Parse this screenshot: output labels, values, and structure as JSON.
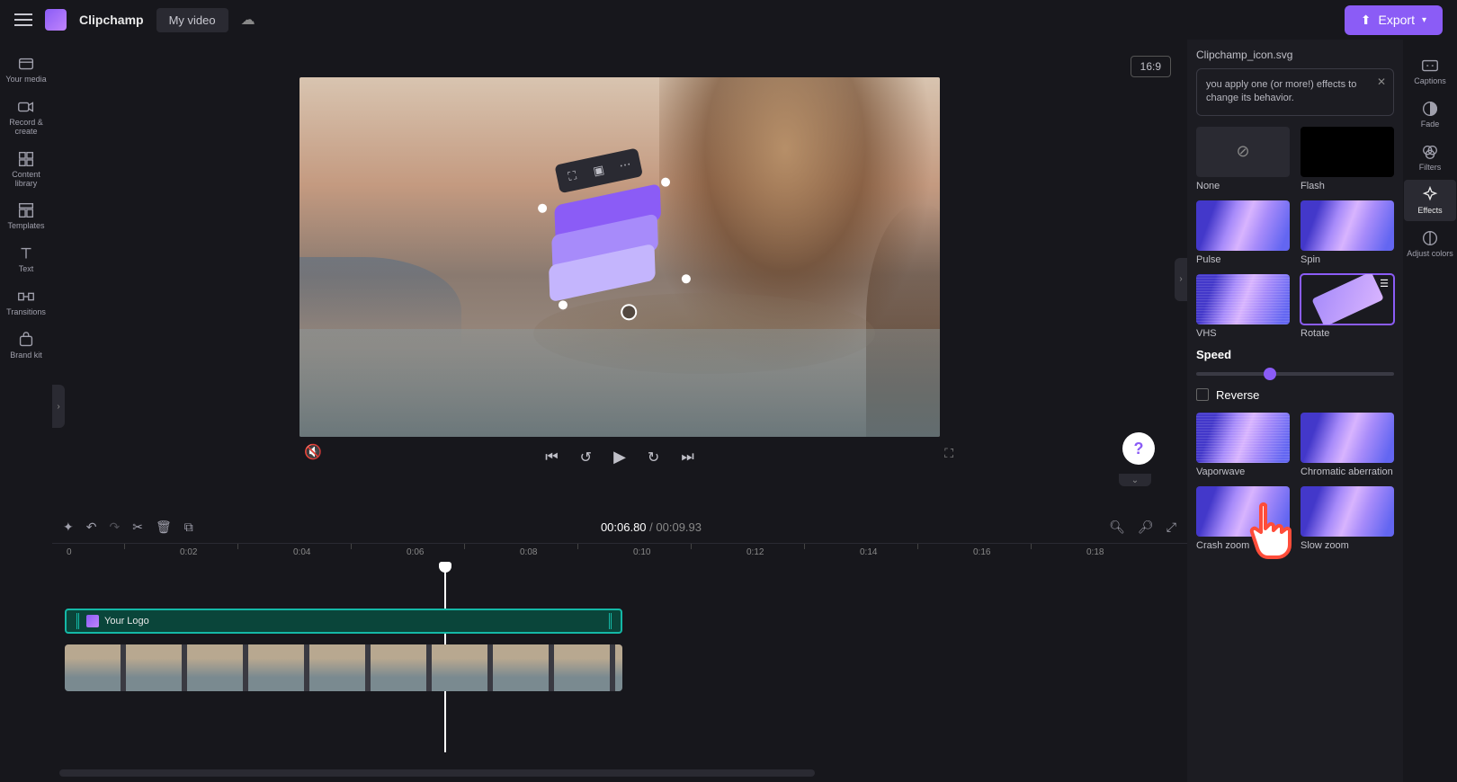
{
  "topbar": {
    "brand": "Clipchamp",
    "tab": "My video",
    "export": "Export"
  },
  "leftNav": {
    "items": [
      {
        "label": "Your media"
      },
      {
        "label": "Record & create"
      },
      {
        "label": "Content library"
      },
      {
        "label": "Templates"
      },
      {
        "label": "Text"
      },
      {
        "label": "Transitions"
      },
      {
        "label": "Brand kit"
      }
    ]
  },
  "canvas": {
    "aspect": "16:9"
  },
  "playback": {
    "current": "00:06.80",
    "sep": " / ",
    "total": "00:09.93"
  },
  "ruler": {
    "ticks": [
      "0",
      "0:02",
      "0:04",
      "0:06",
      "0:08",
      "0:10",
      "0:12",
      "0:14",
      "0:16",
      "0:18"
    ]
  },
  "tracks": {
    "logoClip": "Your Logo"
  },
  "panel": {
    "title": "Clipchamp_icon.svg",
    "tip": "you apply one (or more!) effects to change its behavior.",
    "speed": "Speed",
    "reverse": "Reverse",
    "effects": [
      {
        "label": "None"
      },
      {
        "label": "Flash"
      },
      {
        "label": "Pulse"
      },
      {
        "label": "Spin"
      },
      {
        "label": "VHS"
      },
      {
        "label": "Rotate"
      },
      {
        "label": "Vaporwave"
      },
      {
        "label": "Chromatic aberration"
      },
      {
        "label": "Crash zoom"
      },
      {
        "label": "Slow zoom"
      }
    ]
  },
  "rightNav": {
    "items": [
      {
        "label": "Captions"
      },
      {
        "label": "Fade"
      },
      {
        "label": "Filters"
      },
      {
        "label": "Effects"
      },
      {
        "label": "Adjust colors"
      }
    ]
  }
}
